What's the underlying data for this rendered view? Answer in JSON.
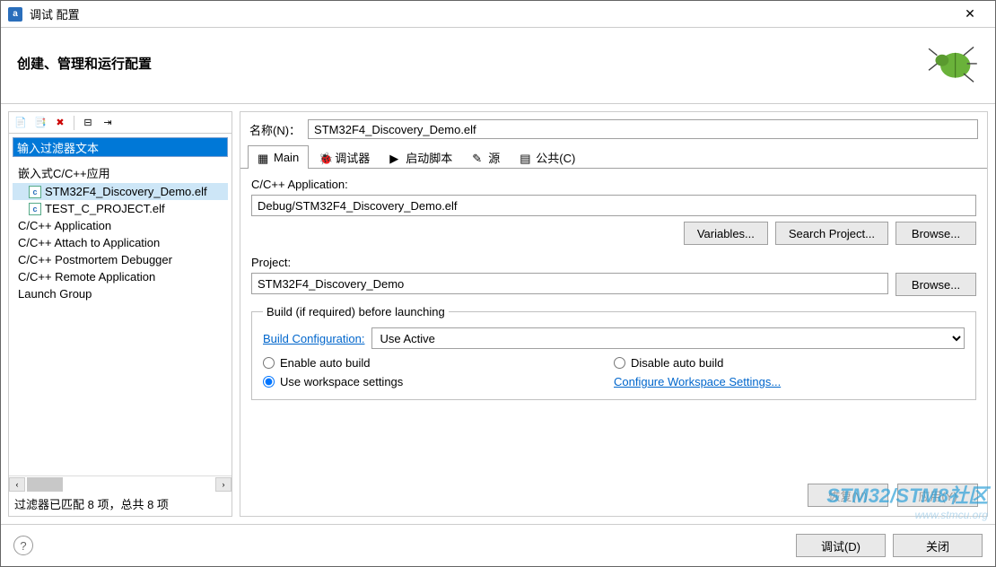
{
  "window": {
    "title": "调试 配置"
  },
  "header": {
    "heading": "创建、管理和运行配置"
  },
  "left": {
    "filter_placeholder": "输入过滤器文本",
    "filter_value": "输入过滤器文本",
    "tree": [
      {
        "label": "嵌入式C/C++应用",
        "type": "group"
      },
      {
        "label": "STM32F4_Discovery_Demo.elf",
        "type": "file",
        "selected": true
      },
      {
        "label": "TEST_C_PROJECT.elf",
        "type": "file"
      },
      {
        "label": "C/C++ Application",
        "type": "group"
      },
      {
        "label": "C/C++ Attach to Application",
        "type": "group"
      },
      {
        "label": "C/C++ Postmortem Debugger",
        "type": "group"
      },
      {
        "label": "C/C++ Remote Application",
        "type": "group"
      },
      {
        "label": "Launch Group",
        "type": "group"
      }
    ],
    "status": "过滤器已匹配 8 项，总共 8 项"
  },
  "right": {
    "name_label": "名称(N)：",
    "name_value": "STM32F4_Discovery_Demo.elf",
    "tabs": [
      "Main",
      "调试器",
      "启动脚本",
      "源",
      "公共(C)"
    ],
    "app_label": "C/C++ Application:",
    "app_value": "Debug/STM32F4_Discovery_Demo.elf",
    "buttons": {
      "variables": "Variables...",
      "search_project": "Search Project...",
      "browse1": "Browse...",
      "browse2": "Browse..."
    },
    "project_label": "Project:",
    "project_value": "STM32F4_Discovery_Demo",
    "fieldset": {
      "legend": "Build (if required) before launching",
      "build_config_label": "Build Configuration:",
      "build_config_value": "Use Active",
      "radio_enable": "Enable auto build",
      "radio_disable": "Disable auto build",
      "radio_workspace": "Use workspace settings",
      "configure_link": "Configure Workspace Settings..."
    },
    "footer": {
      "revert": "恢复(V)",
      "apply": "应用(Y)"
    }
  },
  "bottom": {
    "debug": "调试(D)",
    "close": "关闭"
  },
  "watermark": {
    "line1": "STM32/STM8社区",
    "line2": "www.stmcu.org"
  }
}
